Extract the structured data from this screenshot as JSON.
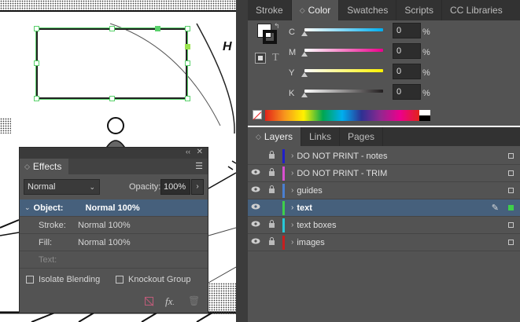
{
  "color_panel": {
    "tabs": [
      {
        "label": "Stroke"
      },
      {
        "label": "Color"
      },
      {
        "label": "Swatches"
      },
      {
        "label": "Scripts"
      },
      {
        "label": "CC Libraries"
      }
    ],
    "active_tab": "Color",
    "channels": [
      {
        "label": "C",
        "value": "0",
        "unit": "%",
        "color": "#00aeef"
      },
      {
        "label": "M",
        "value": "0",
        "unit": "%",
        "color": "#ec008c"
      },
      {
        "label": "Y",
        "value": "0",
        "unit": "%",
        "color": "#fff200"
      },
      {
        "label": "K",
        "value": "0",
        "unit": "%",
        "color": "#231f20"
      }
    ]
  },
  "layers_panel": {
    "tabs": [
      {
        "label": "Layers"
      },
      {
        "label": "Links"
      },
      {
        "label": "Pages"
      }
    ],
    "layers": [
      {
        "name": "DO NOT PRINT - notes",
        "color": "#1f1fc8",
        "visible": false,
        "selected": false
      },
      {
        "name": "DO NOT PRINT - TRIM",
        "color": "#d94fd0",
        "visible": true,
        "selected": false
      },
      {
        "name": "guides",
        "color": "#4a7fd1",
        "visible": true,
        "selected": false
      },
      {
        "name": "text",
        "color": "#3ecf4a",
        "visible": true,
        "selected": true
      },
      {
        "name": "text boxes",
        "color": "#27c8d6",
        "visible": true,
        "selected": false
      },
      {
        "name": "images",
        "color": "#c81e1e",
        "visible": true,
        "selected": false
      }
    ]
  },
  "effects_panel": {
    "title": "Effects",
    "blend_mode": "Normal",
    "opacity_label": "Opacity:",
    "opacity_value": "100%",
    "rows": [
      {
        "label": "Object:",
        "value": "Normal 100%"
      },
      {
        "label": "Stroke:",
        "value": "Normal 100%"
      },
      {
        "label": "Fill:",
        "value": "Normal 100%"
      },
      {
        "label": "Text:",
        "value": ""
      }
    ],
    "isolate_label": "Isolate Blending",
    "knockout_label": "Knockout Group"
  },
  "icons": {
    "fx": "fx",
    "fx_arrow": "."
  },
  "canvas": {
    "label_fragment": "H"
  }
}
